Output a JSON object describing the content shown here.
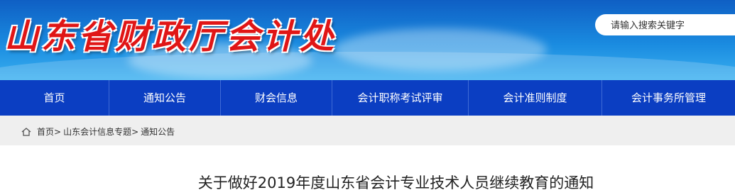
{
  "header": {
    "site_title": "山东省财政厅会计处",
    "search_placeholder": "请输入搜索关键字"
  },
  "nav": [
    {
      "label": "首页"
    },
    {
      "label": "通知公告"
    },
    {
      "label": "财会信息"
    },
    {
      "label": "会计职称考试评审"
    },
    {
      "label": "会计准则制度"
    },
    {
      "label": "会计事务所管理"
    }
  ],
  "breadcrumb": {
    "home": "首页",
    "section": "山东会计信息专题",
    "current": "通知公告",
    "separator": ">"
  },
  "article": {
    "title": "关于做好2019年度山东省会计专业技术人员继续教育的通知"
  },
  "colors": {
    "nav_bg": "#0b3ec2",
    "title_red": "#e01616"
  }
}
